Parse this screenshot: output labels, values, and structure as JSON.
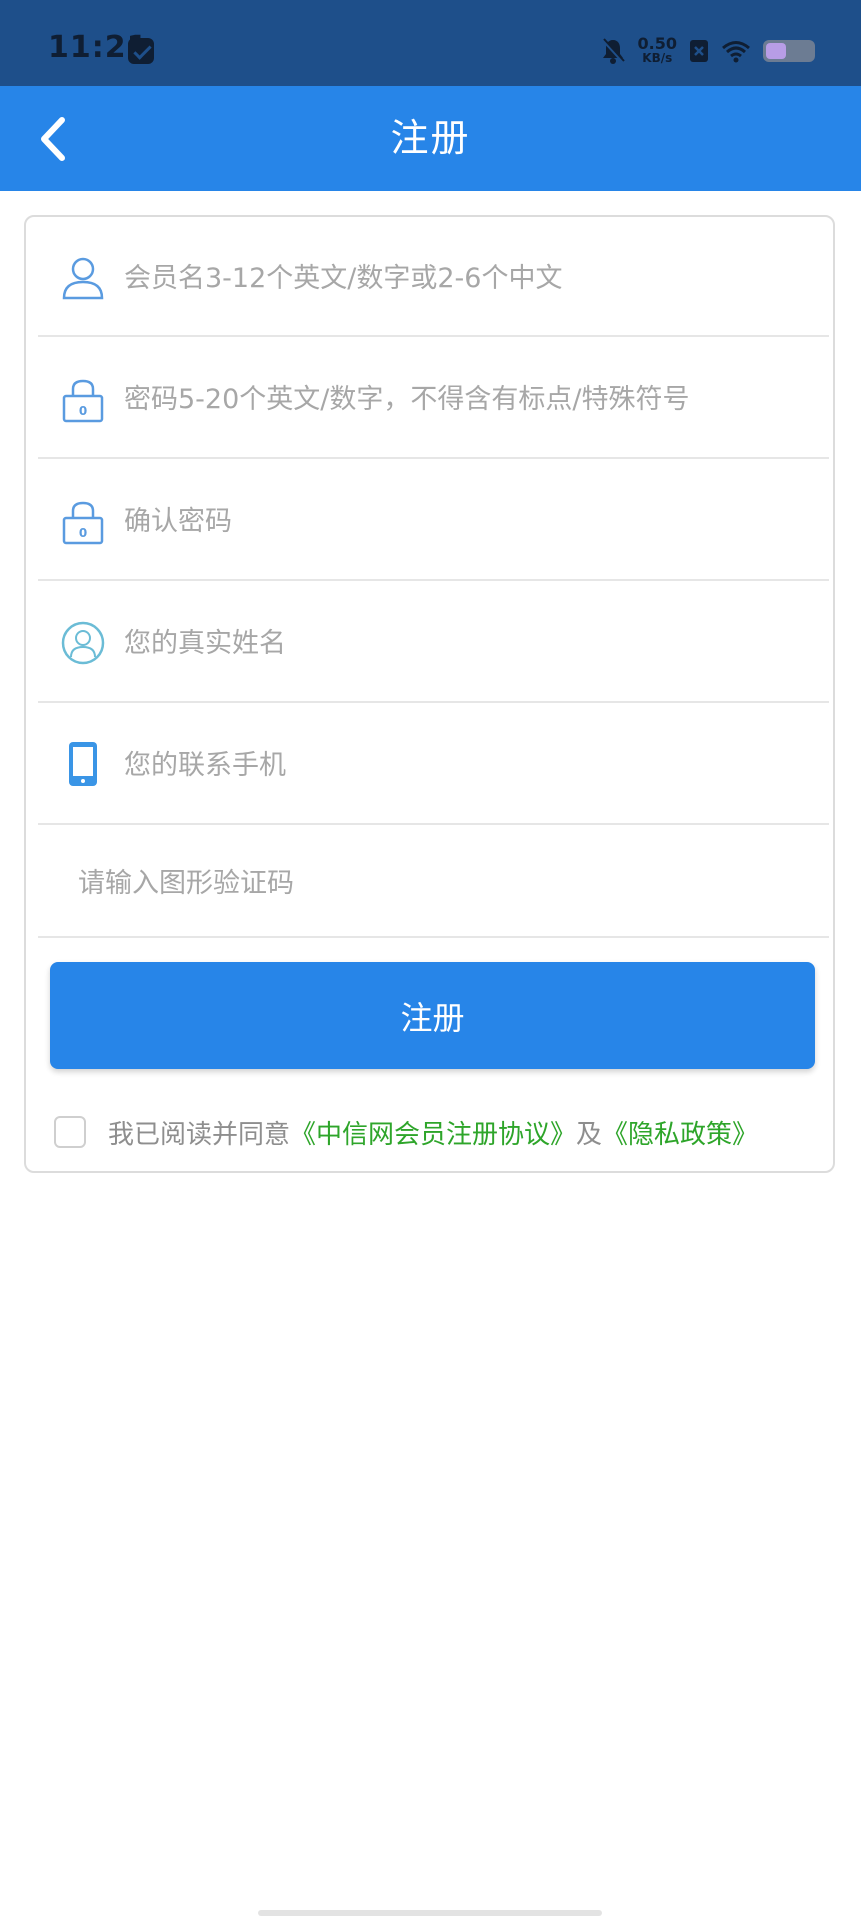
{
  "status_bar": {
    "time": "11:21",
    "net_speed_value": "0.50",
    "net_speed_unit": "KB/s",
    "icons": [
      "message-icon",
      "bell-mute-icon",
      "close-box-icon",
      "wifi-icon",
      "battery-icon"
    ]
  },
  "app_bar": {
    "title": "注册",
    "back_icon": "chevron-left-icon"
  },
  "form": {
    "fields": [
      {
        "icon": "user-icon",
        "placeholder": "会员名3-12个英文/数字或2-6个中文",
        "value": ""
      },
      {
        "icon": "lock-icon",
        "placeholder": "密码5-20个英文/数字，不得含有标点/特殊符号",
        "value": ""
      },
      {
        "icon": "lock-icon",
        "placeholder": "确认密码",
        "value": ""
      },
      {
        "icon": "person-circle-icon",
        "placeholder": "您的真实姓名",
        "value": ""
      },
      {
        "icon": "phone-icon",
        "placeholder": "您的联系手机",
        "value": ""
      },
      {
        "icon": "",
        "placeholder": "请输入图形验证码",
        "value": ""
      }
    ],
    "submit_label": "注册",
    "agreement": {
      "checked": false,
      "prefix": "我已阅读并同意",
      "link1": "《中信网会员注册协议》",
      "middle": "及",
      "link2": "《隐私政策》"
    }
  },
  "colors": {
    "status_bar": "#1e4f8a",
    "app_bar": "#2785e8",
    "button": "#2785e8",
    "link": "#2ea52a",
    "placeholder": "#a7a7a7"
  }
}
